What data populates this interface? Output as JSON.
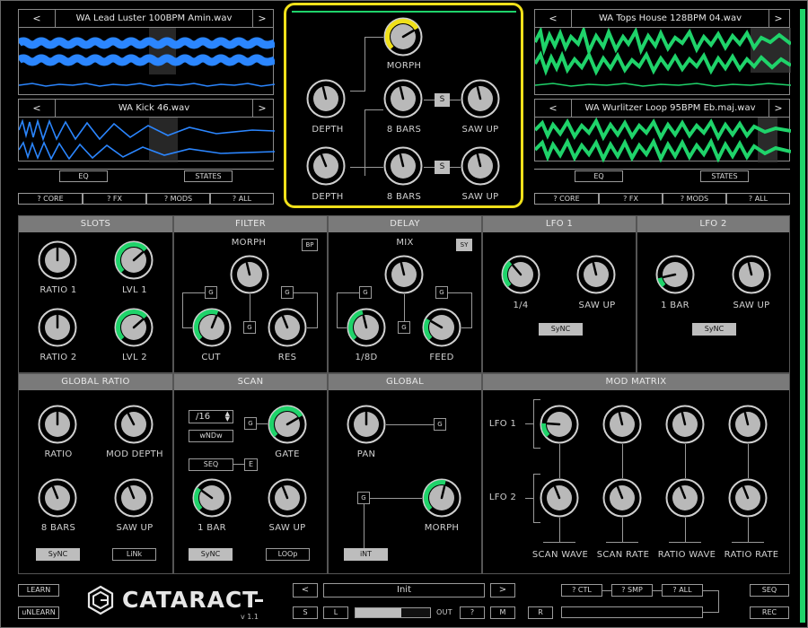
{
  "app": {
    "name": "CATARACT",
    "version": "v 1.1"
  },
  "colors": {
    "accent_green": "#1fd36a",
    "accent_yellow": "#f0e01a",
    "accent_blue": "#2b86ff"
  },
  "samples": {
    "left_top": {
      "name": "WA Lead Luster 100BPM Amin.wav"
    },
    "left_bottom": {
      "name": "WA Kick 46.wav"
    },
    "right_top": {
      "name": "WA Tops House 128BPM 04.wav"
    },
    "right_bottom": {
      "name": "WA Wurlitzer Loop 95BPM Eb.maj.wav"
    },
    "prev": "<",
    "next": ">"
  },
  "tool_buttons": {
    "eq": "EQ",
    "states": "STATES",
    "core": "? CORE",
    "fx": "? FX",
    "mods": "? MODS",
    "all": "? ALL"
  },
  "center": {
    "morph": "MORPH",
    "depth1": "DEPTH",
    "bars1": "8 BARS",
    "saw1": "SAW UP",
    "depth2": "DEPTH",
    "bars2": "8 BARS",
    "saw2": "SAW UP",
    "s": "S"
  },
  "slots": {
    "title": "SLOTS",
    "ratio1": "RATIO 1",
    "lvl1": "LVL 1",
    "ratio2": "RATIO 2",
    "lvl2": "LVL 2"
  },
  "filter": {
    "title": "FILTER",
    "morph": "MORPH",
    "bp": "BP",
    "cut": "CUT",
    "res": "RES",
    "g": "G"
  },
  "delay": {
    "title": "DELAY",
    "mix": "MIX",
    "sy": "SY",
    "time": "1/8D",
    "feed": "FEED",
    "g": "G"
  },
  "lfo1": {
    "title": "LFO 1",
    "rate": "1/4",
    "shape": "SAW UP",
    "sync": "SyNC"
  },
  "lfo2": {
    "title": "LFO 2",
    "rate": "1 BAR",
    "shape": "SAW UP",
    "sync": "SyNC"
  },
  "global_ratio": {
    "title": "GLOBAL RATIO",
    "ratio": "RATIO",
    "mod_depth": "MOD DEPTH",
    "bars": "8 BARS",
    "saw": "SAW UP",
    "sync": "SyNC",
    "link": "LiNk"
  },
  "scan": {
    "title": "SCAN",
    "div": "/16",
    "wndw": "wNDw",
    "seq": "SEQ",
    "e": "E",
    "g": "G",
    "gate": "GATE",
    "bar": "1 BAR",
    "saw": "SAW UP",
    "sync": "SyNC",
    "loop": "LOOp"
  },
  "global": {
    "title": "GLOBAL",
    "pan": "PAN",
    "morph": "MORPH",
    "int": "iNT",
    "g": "G"
  },
  "mod_matrix": {
    "title": "MOD MATRIX",
    "lfo1": "LFO 1",
    "lfo2": "LFO 2",
    "targets": [
      "SCAN WAVE",
      "SCAN RATE",
      "RATIO WAVE",
      "RATIO RATE"
    ]
  },
  "footer": {
    "learn": "LEARN",
    "unlearn": "uNLEARN",
    "preset": "Init",
    "prev": "<",
    "next": ">",
    "s": "S",
    "l": "L",
    "out": "OUT",
    "q": "?",
    "m": "M",
    "r": "R",
    "ctl": "? CTL",
    "smp": "? SMP",
    "all": "? ALL",
    "seq": "SEQ",
    "rec": "REC"
  },
  "levels": {
    "output_meter": 0.62,
    "scrollbar": 1.0
  }
}
